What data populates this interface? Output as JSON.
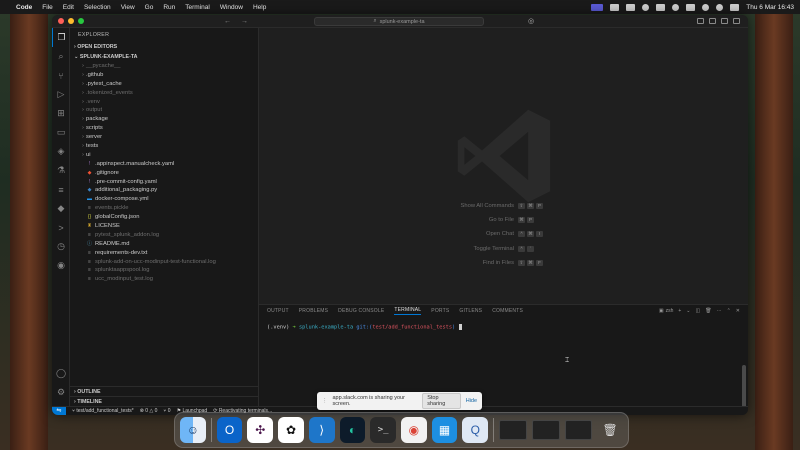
{
  "menubar": {
    "app": "Code",
    "menus": [
      "File",
      "Edit",
      "Selection",
      "View",
      "Go",
      "Run",
      "Terminal",
      "Window",
      "Help"
    ],
    "datetime": "Thu 6 Mar  16:43"
  },
  "window": {
    "command_center": "splunk-example-ta"
  },
  "explorer": {
    "header": "EXPLORER",
    "open_editors": "OPEN EDITORS",
    "project": "SPLUNK-EXAMPLE-TA",
    "items": [
      {
        "label": "__pycache__",
        "kind": "folder",
        "dim": true
      },
      {
        "label": ".github",
        "kind": "folder",
        "dim": false
      },
      {
        "label": ".pytest_cache",
        "kind": "folder",
        "dim": false
      },
      {
        "label": ".tokenized_events",
        "kind": "folder",
        "dim": true
      },
      {
        "label": ".venv",
        "kind": "folder",
        "dim": true
      },
      {
        "label": "output",
        "kind": "folder",
        "dim": true
      },
      {
        "label": "package",
        "kind": "folder",
        "dim": false
      },
      {
        "label": "scripts",
        "kind": "folder",
        "dim": false
      },
      {
        "label": "server",
        "kind": "folder",
        "dim": false
      },
      {
        "label": "tests",
        "kind": "folder",
        "dim": false
      },
      {
        "label": "ui",
        "kind": "folder",
        "dim": false
      },
      {
        "label": ".appinspect.manualcheck.yaml",
        "kind": "yaml",
        "dim": false
      },
      {
        "label": ".gitignore",
        "kind": "git",
        "dim": false
      },
      {
        "label": ".pre-commit-config.yaml",
        "kind": "yaml",
        "dim": false
      },
      {
        "label": "additional_packaging.py",
        "kind": "python",
        "dim": false
      },
      {
        "label": "docker-compose.yml",
        "kind": "docker",
        "dim": false
      },
      {
        "label": "events.pickle",
        "kind": "file",
        "dim": true
      },
      {
        "label": "globalConfig.json",
        "kind": "json",
        "dim": false
      },
      {
        "label": "LICENSE",
        "kind": "license",
        "dim": false
      },
      {
        "label": "pytest_splunk_addon.log",
        "kind": "log",
        "dim": true
      },
      {
        "label": "README.md",
        "kind": "md",
        "dim": false
      },
      {
        "label": "requirements-dev.txt",
        "kind": "txt",
        "dim": false
      },
      {
        "label": "splunk-add-on-ucc-modinput-test-functional.log",
        "kind": "log",
        "dim": true
      },
      {
        "label": "splunktaappspool.log",
        "kind": "log",
        "dim": true
      },
      {
        "label": "ucc_modinput_test.log",
        "kind": "log",
        "dim": true
      }
    ],
    "outline": "OUTLINE",
    "timeline": "TIMELINE"
  },
  "editor": {
    "shortcuts": [
      {
        "label": "Show All Commands",
        "keys": [
          "⇧",
          "⌘",
          "P"
        ]
      },
      {
        "label": "Go to File",
        "keys": [
          "⌘",
          "P"
        ]
      },
      {
        "label": "Open Chat",
        "keys": [
          "^",
          "⌘",
          "I"
        ]
      },
      {
        "label": "Toggle Terminal",
        "keys": [
          "^",
          "`"
        ]
      },
      {
        "label": "Find in Files",
        "keys": [
          "⇧",
          "⌘",
          "F"
        ]
      }
    ]
  },
  "panel": {
    "tabs": [
      "OUTPUT",
      "PROBLEMS",
      "DEBUG CONSOLE",
      "TERMINAL",
      "PORTS",
      "GITLENS",
      "COMMENTS"
    ],
    "active_tab": "TERMINAL",
    "shell": "zsh",
    "prompt": {
      "venv": "(.venv)",
      "arrow": "➜",
      "dir": "splunk-example-ta",
      "git": "git:(",
      "branch": "test/add_functional_tests",
      "git_close": ")"
    }
  },
  "statusbar": {
    "branch": "test/add_functional_tests*",
    "errors": "⊗ 0 △ 0",
    "ports": "⑂ 0",
    "launchpad": "Launchpad",
    "activity": "Reactivating terminals..."
  },
  "sharebar": {
    "message": "app.slack.com is sharing your screen.",
    "stop": "Stop sharing",
    "hide": "Hide"
  },
  "dock": [
    "finder",
    "outlook",
    "slack",
    "chatgpt",
    "vscode",
    "webex",
    "terminal",
    "chrome",
    "docker",
    "quicktime"
  ]
}
